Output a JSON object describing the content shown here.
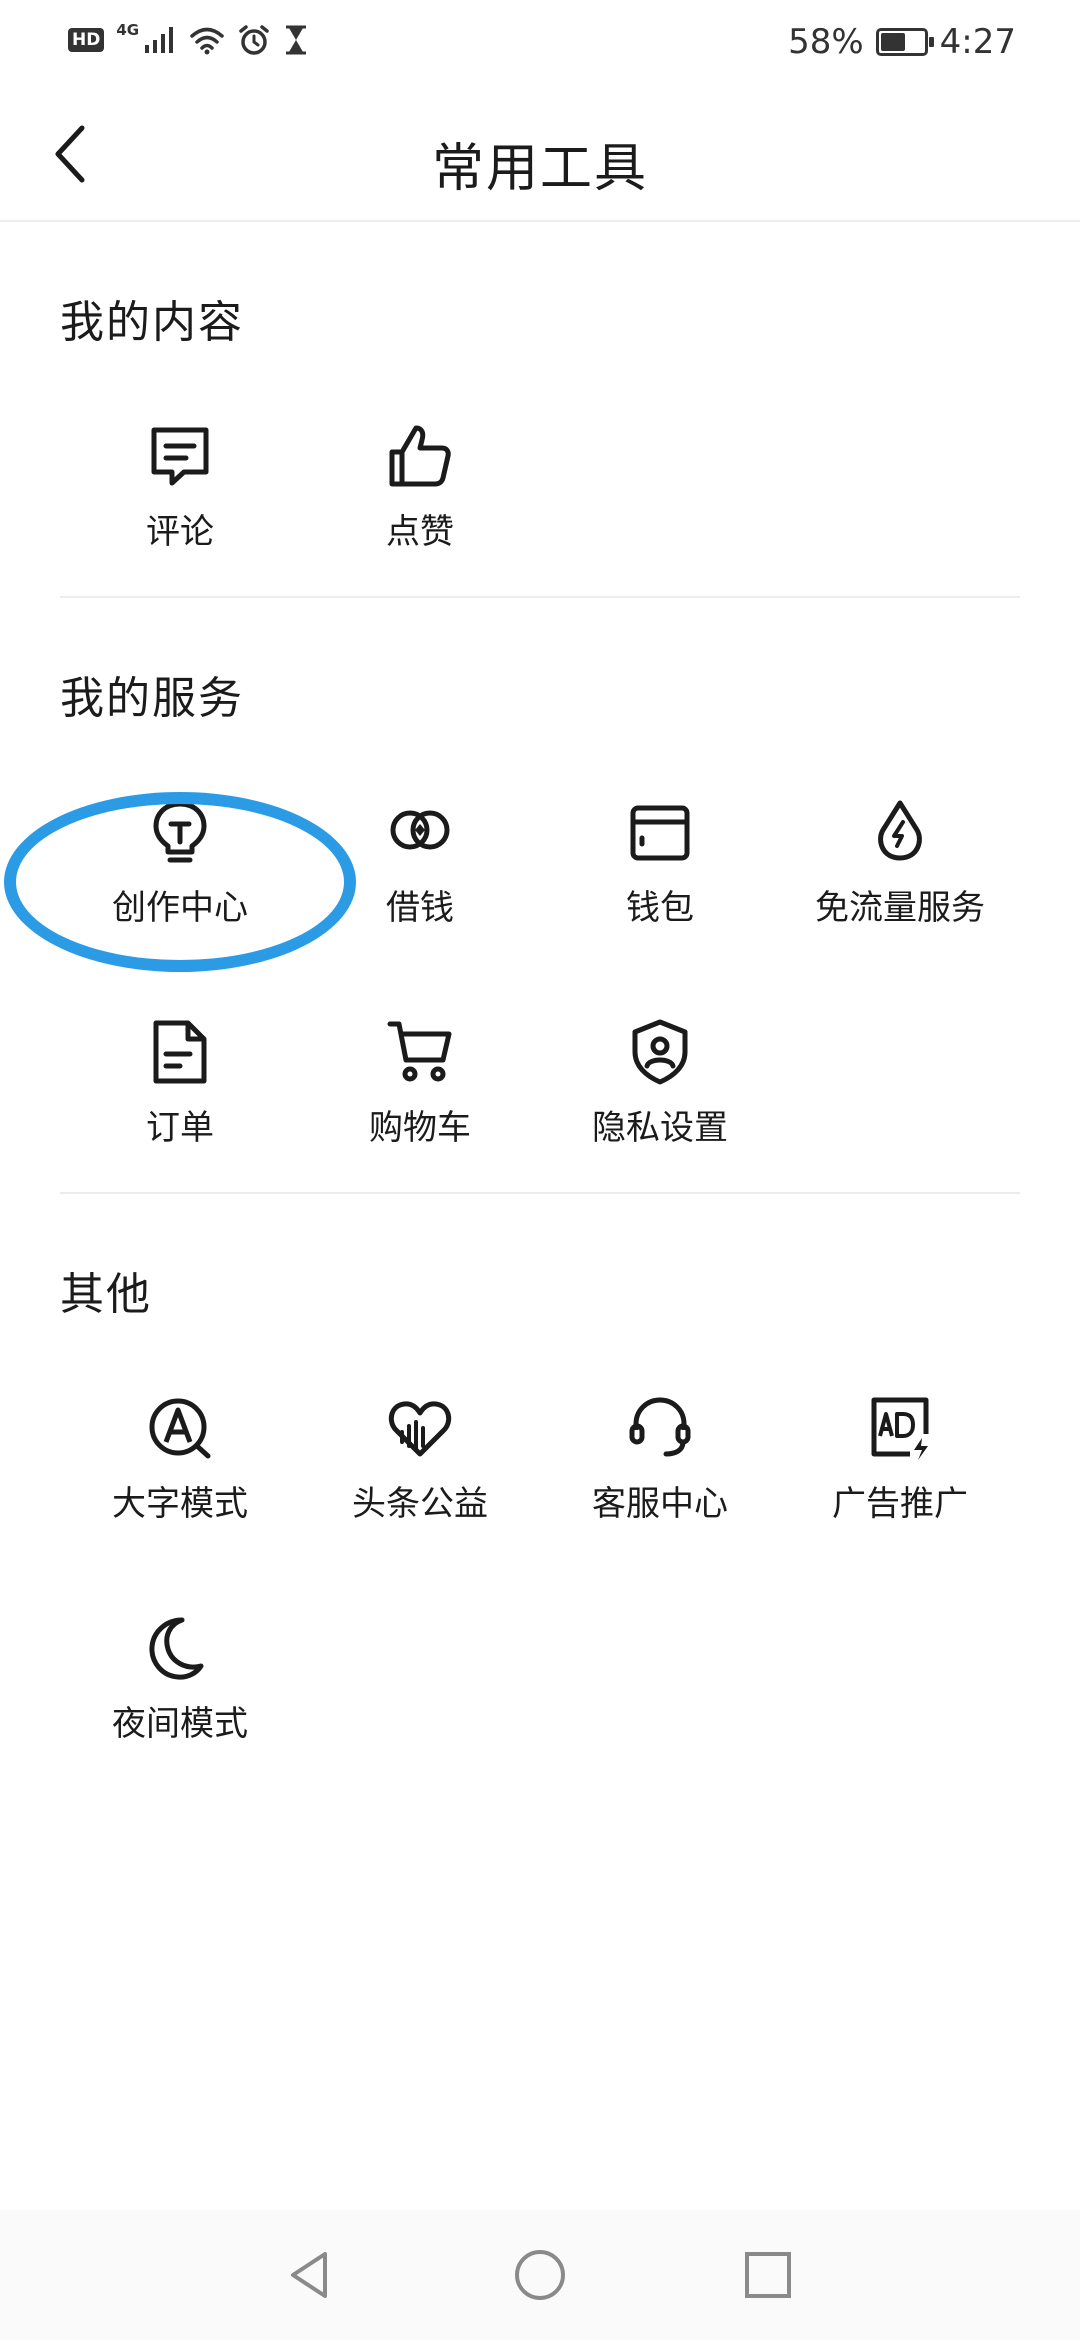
{
  "status_bar": {
    "hd_badge": "HD",
    "network_type": "4G",
    "battery_percent": "58%",
    "battery_level": 0.58,
    "time": "4:27"
  },
  "header": {
    "title": "常用工具",
    "back_icon": "chevron-left-icon"
  },
  "sections": {
    "content": {
      "title": "我的内容",
      "items": [
        {
          "label": "评论",
          "icon": "comment-icon"
        },
        {
          "label": "点赞",
          "icon": "thumbs-up-icon"
        }
      ]
    },
    "services": {
      "title": "我的服务",
      "items": [
        {
          "label": "创作中心",
          "icon": "lightbulb-icon"
        },
        {
          "label": "借钱",
          "icon": "loan-icon"
        },
        {
          "label": "钱包",
          "icon": "wallet-icon"
        },
        {
          "label": "免流量服务",
          "icon": "data-drop-icon"
        },
        {
          "label": "订单",
          "icon": "order-document-icon"
        },
        {
          "label": "购物车",
          "icon": "shopping-cart-icon"
        },
        {
          "label": "隐私设置",
          "icon": "privacy-shield-icon"
        }
      ]
    },
    "other": {
      "title": "其他",
      "items": [
        {
          "label": "大字模式",
          "icon": "large-font-icon"
        },
        {
          "label": "头条公益",
          "icon": "charity-heart-icon"
        },
        {
          "label": "客服中心",
          "icon": "headset-icon"
        },
        {
          "label": "广告推广",
          "icon": "ad-icon"
        },
        {
          "label": "夜间模式",
          "icon": "moon-icon"
        }
      ]
    }
  },
  "colors": {
    "text": "#1b1b1b",
    "divider": "#ececec",
    "highlight": "#2c9be6"
  }
}
